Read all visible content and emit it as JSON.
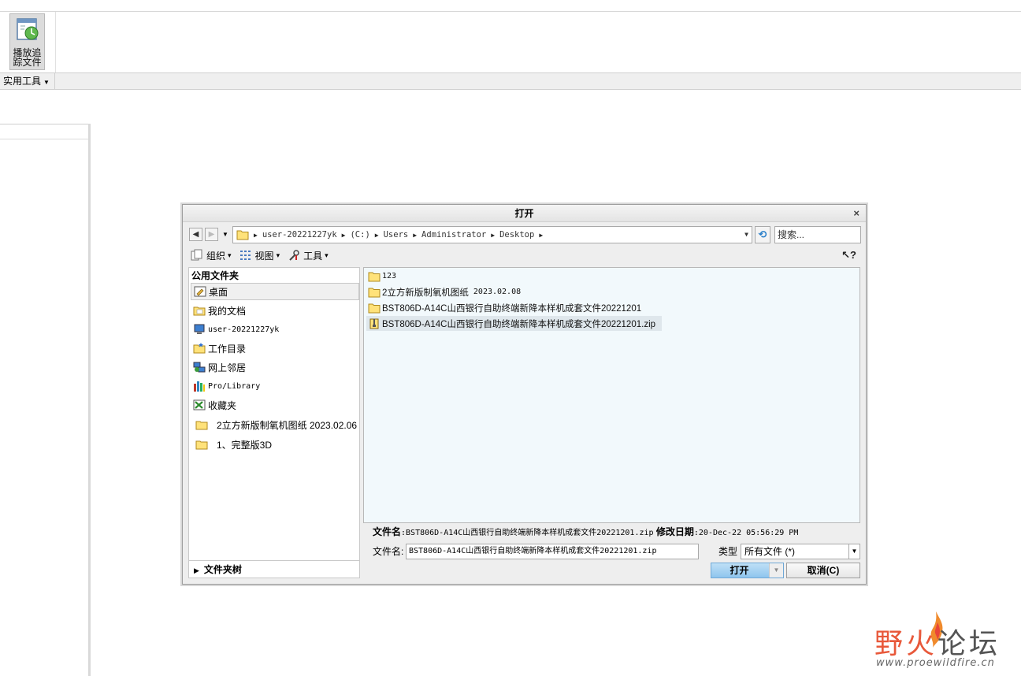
{
  "ribbon": {
    "play_trail_label_line1": "播放追",
    "play_trail_label_line2": "踪文件",
    "group_label": "实用工具",
    "group_arrow": "▼"
  },
  "dialog": {
    "title": "打开",
    "close": "×",
    "nav": {
      "back": "◀",
      "forward": "▶",
      "history": "▼",
      "path": [
        "user-20221227yk",
        "(C:)",
        "Users",
        "Administrator",
        "Desktop"
      ],
      "refresh": "⟲",
      "search_placeholder": "搜索..."
    },
    "toolbar": {
      "organize": "组织",
      "view": "视图",
      "tools": "工具",
      "dropdown": "▾",
      "help": "?"
    },
    "places": {
      "header": "公用文件夹",
      "items": [
        {
          "label": "桌面",
          "icon": "desktop-icon"
        },
        {
          "label": "我的文档",
          "icon": "my-documents-icon"
        },
        {
          "label": "user-20221227yk",
          "icon": "computer-icon"
        },
        {
          "label": "工作目录",
          "icon": "working-directory-icon"
        },
        {
          "label": "网上邻居",
          "icon": "network-icon"
        },
        {
          "label": "Pro/Library",
          "icon": "library-icon"
        },
        {
          "label": "收藏夹",
          "icon": "favorites-icon"
        },
        {
          "label": "2立方新版制氧机图纸 2023.02.06",
          "icon": "folder-icon"
        },
        {
          "label": "1、完整版3D",
          "icon": "folder-icon"
        }
      ],
      "folder_tree": "文件夹树",
      "folder_tree_arrow": "▶"
    },
    "files": [
      {
        "name": "123",
        "date": "",
        "type": "folder"
      },
      {
        "name": "2立方新版制氧机图纸",
        "date": "2023.02.08",
        "type": "folder"
      },
      {
        "name": "BST806D-A14C山西银行自助终端新降本样机成套文件20221201",
        "date": "",
        "type": "folder"
      },
      {
        "name": "BST806D-A14C山西银行自助终端新降本样机成套文件20221201.zip",
        "date": "",
        "type": "zip"
      }
    ],
    "info": {
      "filename_label": "文件名",
      "filename_value": ":BST806D-A14C山西银行自助终端新降本样机成套文件20221201.zip",
      "modified_label": "修改日期",
      "modified_value": ":20-Dec-22 05:56:29 PM"
    },
    "filename_field": {
      "label": "文件名:",
      "value": "BST806D-A14C山西银行自助终端新降本样机成套文件20221201.zip"
    },
    "type_field": {
      "label": "类型",
      "value": "所有文件 (*)"
    },
    "buttons": {
      "open": "打开",
      "cancel": "取消(C)"
    }
  },
  "watermark": {
    "cn_part1": "野火",
    "cn_part2": "论坛",
    "url": "www.proewildfire.cn"
  },
  "colors": {
    "accent_open": "#8ec5ee",
    "list_bg": "#f2f9fc",
    "watermark": "#e8583a"
  }
}
